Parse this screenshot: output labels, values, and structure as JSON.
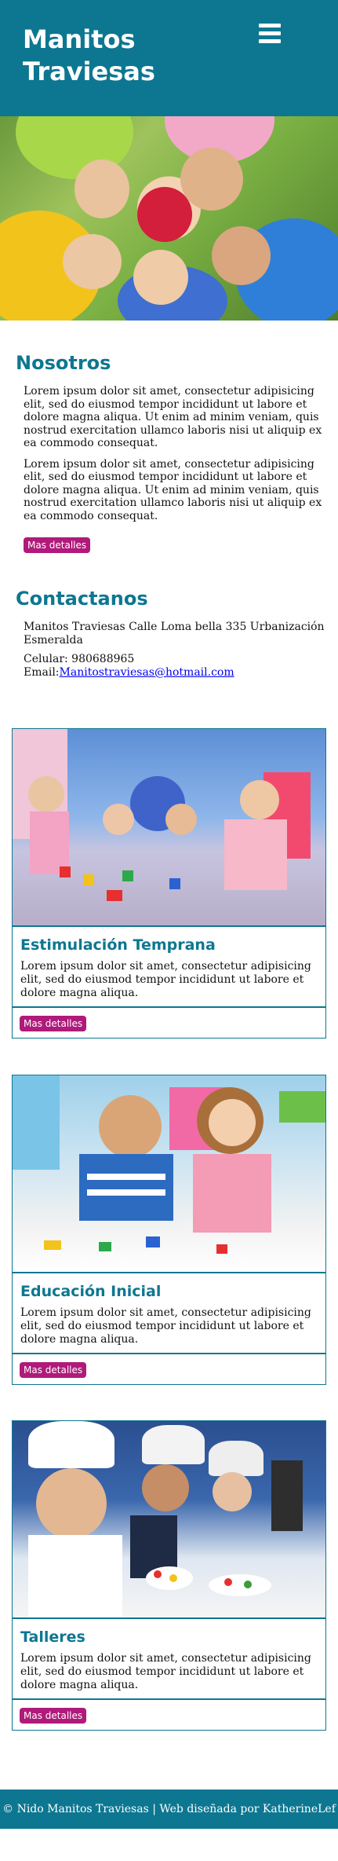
{
  "brand": {
    "title": "Manitos Traviesas"
  },
  "header": {
    "menu_icon": "hamburger-menu-icon"
  },
  "about": {
    "heading": "Nosotros",
    "paragraphs": [
      "Lorem ipsum dolor sit amet, consectetur adipisicing elit, sed do eiusmod tempor incididunt ut labore et dolore magna aliqua. Ut enim ad minim veniam, quis nostrud exercitation ullamco laboris nisi ut aliquip ex ea commodo consequat.",
      "Lorem ipsum dolor sit amet, consectetur adipisicing elit, sed do eiusmod tempor incididunt ut labore et dolore magna aliqua. Ut enim ad minim veniam, quis nostrud exercitation ullamco laboris nisi ut aliquip ex ea commodo consequat."
    ],
    "button_label": "Mas detalles"
  },
  "contact": {
    "heading": "Contactanos",
    "address": "Manitos Traviesas Calle Loma bella 335 Urbanización Esmeralda",
    "phone_label": "Celular: 980688965 Email:",
    "email": "Manitostraviesas@hotmail.com"
  },
  "cards": [
    {
      "title": "Estimulación Temprana",
      "text": "Lorem ipsum dolor sit amet, consectetur adipisicing elit, sed do eiusmod tempor incididunt ut labore et dolore magna aliqua.",
      "button_label": "Mas detalles"
    },
    {
      "title": "Educación Inicial",
      "text": "Lorem ipsum dolor sit amet, consectetur adipisicing elit, sed do eiusmod tempor incididunt ut labore et dolore magna aliqua.",
      "button_label": "Mas detalles"
    },
    {
      "title": "Talleres",
      "text": "Lorem ipsum dolor sit amet, consectetur adipisicing elit, sed do eiusmod tempor incididunt ut labore et dolore magna aliqua.",
      "button_label": "Mas detalles"
    }
  ],
  "footer": {
    "text": "© Nido Manitos Traviesas | Web diseñada por KatherineLef"
  },
  "colors": {
    "primary": "#0d7791",
    "accent": "#b01a7a",
    "link": "#0000ee"
  }
}
